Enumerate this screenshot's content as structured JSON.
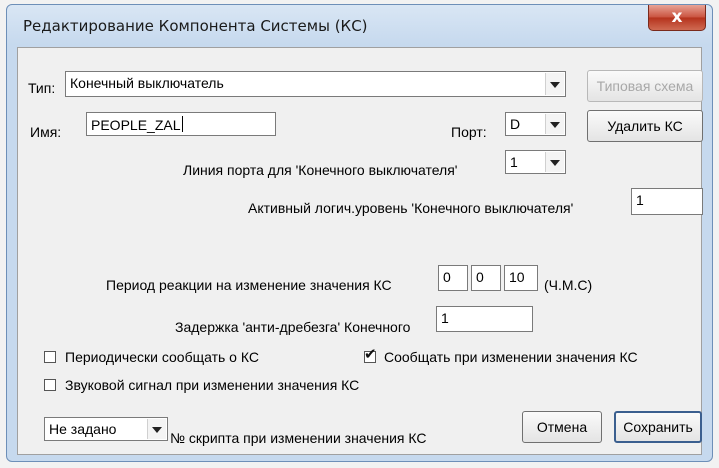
{
  "window": {
    "title": "Редактирование Компонента Системы (КС)",
    "close_glyph": "x"
  },
  "type": {
    "label": "Тип:",
    "value": "Конечный выключатель"
  },
  "name": {
    "label": "Имя:",
    "value": "PEOPLE_ZAL"
  },
  "buttons": {
    "template": "Типовая схема",
    "delete": "Удалить КС",
    "cancel": "Отмена",
    "save": "Сохранить"
  },
  "port": {
    "label": "Порт:",
    "value": "D"
  },
  "port_line": {
    "label": "Линия порта для 'Конечного выключателя'",
    "value": "1"
  },
  "active_level": {
    "label": "Активный логич.уровень  'Конечного выключателя'",
    "value": "1"
  },
  "period": {
    "label": "Период реакции на изменение значения КС",
    "hours": "0",
    "minutes": "0",
    "seconds": "10",
    "unit": "(Ч.М.С)"
  },
  "debounce": {
    "label": "Задержка 'анти-дребезга' Конечного",
    "value": "1"
  },
  "checkboxes": {
    "periodic_report": {
      "label": "Периодически сообщать о КС",
      "checked": false
    },
    "report_on_change": {
      "label": "Сообщать при изменении значения КС",
      "checked": true
    },
    "sound_on_change": {
      "label": "Звуковой сигнал при изменении значения КС",
      "checked": false
    }
  },
  "script": {
    "value": "Не задано",
    "label": "№ скрипта при изменении значения КС"
  },
  "check_mark": "✔"
}
